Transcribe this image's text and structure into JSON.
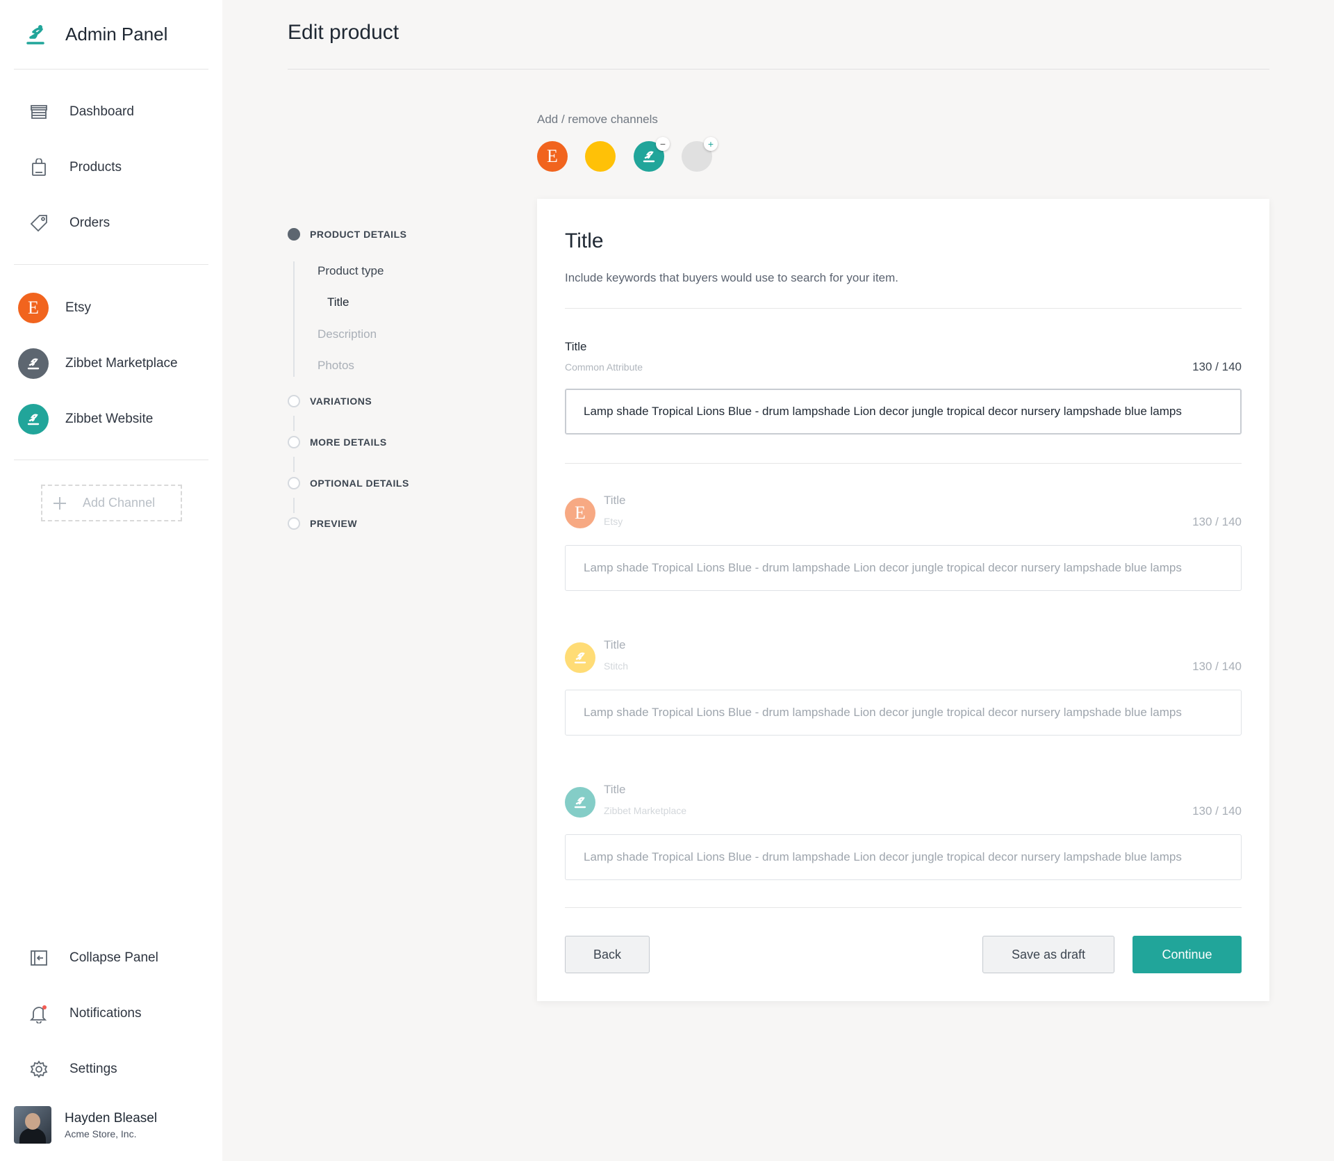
{
  "app": {
    "title": "Admin Panel"
  },
  "sidebar": {
    "nav": [
      {
        "label": "Dashboard",
        "icon": "store-icon"
      },
      {
        "label": "Products",
        "icon": "bag-icon"
      },
      {
        "label": "Orders",
        "icon": "tag-icon"
      }
    ],
    "channels": [
      {
        "label": "Etsy",
        "letter": "E",
        "color": "#f1641e"
      },
      {
        "label": "Zibbet Marketplace",
        "color": "#5d6670"
      },
      {
        "label": "Zibbet Website",
        "color": "#21a59a"
      }
    ],
    "add_channel": "Add Channel",
    "bottom": [
      {
        "label": "Collapse Panel",
        "icon": "collapse-icon"
      },
      {
        "label": "Notifications",
        "icon": "bell-icon"
      },
      {
        "label": "Settings",
        "icon": "gear-icon"
      }
    ],
    "user": {
      "name": "Hayden Bleasel",
      "org": "Acme Store, Inc."
    }
  },
  "page": {
    "title": "Edit product"
  },
  "channels_bar": {
    "label": "Add / remove channels",
    "items": [
      {
        "name": "etsy",
        "letter": "E",
        "color": "#f1641e"
      },
      {
        "name": "stitch",
        "color": "#ffc107"
      },
      {
        "name": "zibbet",
        "color": "#21a59a",
        "badge": "−"
      },
      {
        "name": "add",
        "color": "#e0e0e0",
        "badge": "+"
      }
    ]
  },
  "steps": {
    "items": [
      {
        "label": "PRODUCT DETAILS",
        "active": true
      },
      {
        "label": "VARIATIONS",
        "active": false
      },
      {
        "label": "MORE DETAILS",
        "active": false
      },
      {
        "label": "OPTIONAL DETAILS",
        "active": false
      },
      {
        "label": "PREVIEW",
        "active": false
      }
    ],
    "substeps": [
      {
        "label": "Product type",
        "state": "done"
      },
      {
        "label": "Title",
        "state": "current"
      },
      {
        "label": "Description",
        "state": "pending"
      },
      {
        "label": "Photos",
        "state": "pending"
      }
    ]
  },
  "card": {
    "title": "Title",
    "subtitle": "Include keywords that buyers would use to search for your item.",
    "common": {
      "label": "Title",
      "sub": "Common Attribute",
      "counter": "130 / 140",
      "value": "Lamp shade Tropical Lions Blue - drum lampshade Lion decor jungle tropical decor nursery lampshade blue lamps"
    },
    "channel_fields": [
      {
        "label": "Title",
        "channel": "Etsy",
        "letter": "E",
        "color": "#f1641e",
        "counter": "130 / 140",
        "value": "Lamp shade Tropical Lions Blue - drum lampshade Lion decor jungle tropical decor nursery lampshade blue lamps"
      },
      {
        "label": "Title",
        "channel": "Stitch",
        "color": "#ffc107",
        "counter": "130 / 140",
        "value": "Lamp shade Tropical Lions Blue - drum lampshade Lion decor jungle tropical decor nursery lampshade blue lamps"
      },
      {
        "label": "Title",
        "channel": "Zibbet Marketplace",
        "color": "#21a59a",
        "counter": "130 / 140",
        "value": "Lamp shade Tropical Lions Blue - drum lampshade Lion decor jungle tropical decor nursery lampshade blue lamps"
      }
    ],
    "buttons": {
      "back": "Back",
      "draft": "Save as draft",
      "continue": "Continue"
    }
  }
}
